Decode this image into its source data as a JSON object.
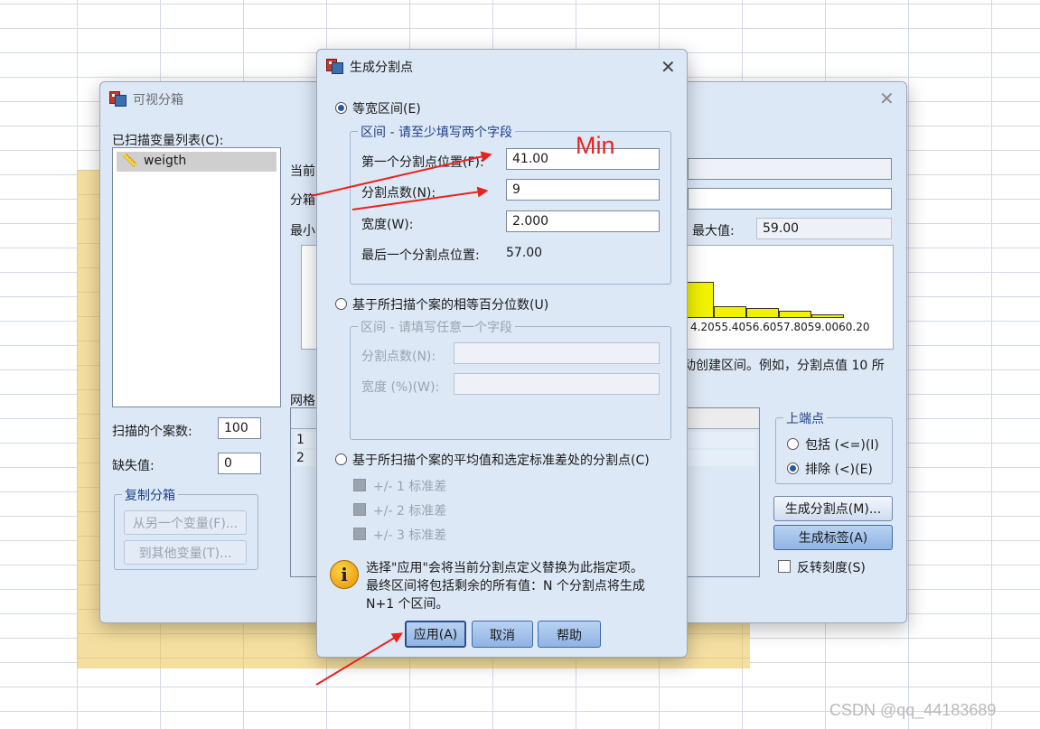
{
  "background": {
    "watermark": "CSDN @qq_44183689"
  },
  "main_dialog": {
    "title": "可视分箱",
    "scanned_var_list_label": "已扫描变量列表(C):",
    "variables": [
      "weigth"
    ],
    "current_label": "当前",
    "bin_label": "分箱",
    "min_label": "最小",
    "max_label": "最大值:",
    "max_value": "59.00",
    "hist_tick_labels": "4.2055.4056.6057.8059.0060.20",
    "hist_bar_values": [
      0.55,
      0.18,
      0.15,
      0.11,
      0.05
    ],
    "instruction_text_1": "动创建区间。例如，分割点值 10 所",
    "instruction_text_2": "。",
    "grid_label": "网格",
    "grid_rows": [
      "1",
      "2"
    ],
    "cases_label": "扫描的个案数:",
    "cases_value": "100",
    "missing_label": "缺失值:",
    "missing_value": "0",
    "copy_group_title": "复制分箱",
    "copy_from_btn": "从另一个变量(F)...",
    "copy_to_btn": "到其他变量(T)...",
    "endpoint_group_title": "上端点",
    "endpoint_include": "包括 (<=)(I)",
    "endpoint_exclude": "排除 (<)(E)",
    "make_cutpoints_btn": "生成分割点(M)...",
    "make_labels_btn": "生成标签(A)",
    "reverse_scale": "反转刻度(S)"
  },
  "cutpoint_dialog": {
    "title": "生成分割点",
    "equal_width_label": "等宽区间(E)",
    "equal_width_group": "区间 - 请至少填写两个字段",
    "first_cut_label": "第一个分割点位置(F):",
    "first_cut_value": "41.00",
    "num_cuts_label": "分割点数(N):",
    "num_cuts_value": "9",
    "width_label": "宽度(W):",
    "width_value": "2.000",
    "last_cut_label": "最后一个分割点位置:",
    "last_cut_value": "57.00",
    "percentile_label": "基于所扫描个案的相等百分位数(U)",
    "percentile_group": "区间 - 请填写任意一个字段",
    "pct_num_cuts_label": "分割点数(N):",
    "pct_width_label": "宽度 (%)(W):",
    "sd_label": "基于所扫描个案的平均值和选定标准差处的分割点(C)",
    "sd1": "+/- 1 标准差",
    "sd2": "+/- 2 标准差",
    "sd3": "+/- 3 标准差",
    "info_line1": "选择\"应用\"会将当前分割点定义替换为此指定项。",
    "info_line2": "最终区间将包括剩余的所有值：N 个分割点将生成",
    "info_line3": "N+1 个区间。",
    "apply_btn": "应用(A)",
    "cancel_btn": "取消",
    "help_btn": "帮助"
  },
  "annotation": {
    "text": "Min",
    "color": "#e8231e"
  }
}
